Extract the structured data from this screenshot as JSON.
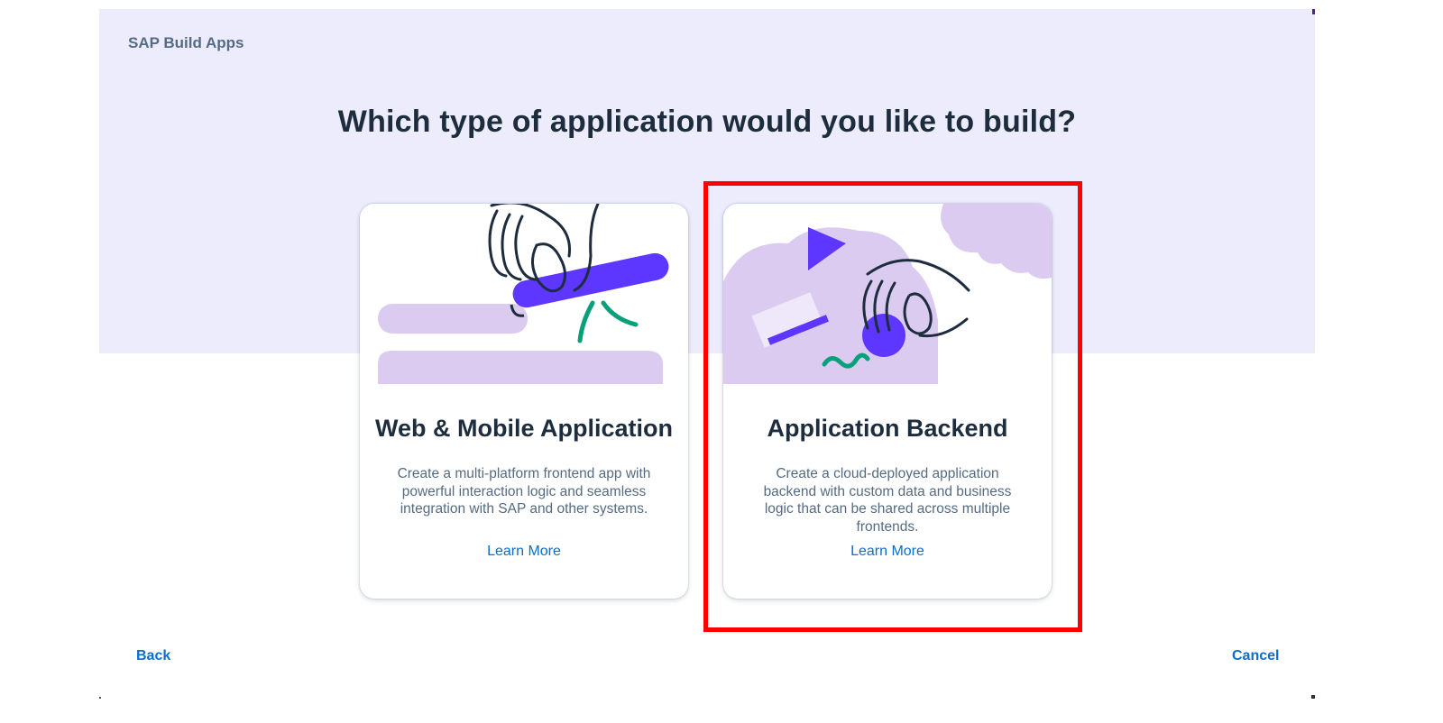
{
  "header": {
    "app_name": "SAP Build Apps"
  },
  "main": {
    "question": "Which type of application would you like to build?",
    "cards": [
      {
        "title": "Web & Mobile Application",
        "description": "Create a multi-platform frontend app with powerful interaction logic and seamless integration with SAP and other systems.",
        "link": "Learn More",
        "icon": "hand-holding-bar-illustration"
      },
      {
        "title": "Application Backend",
        "description": "Create a cloud-deployed application backend with custom data and business logic that can be shared across multiple frontends.",
        "link": "Learn More",
        "icon": "hand-holding-circle-illustration"
      }
    ]
  },
  "footer": {
    "back_label": "Back",
    "cancel_label": "Cancel"
  },
  "colors": {
    "hero_bg": "#ececfd",
    "accent_purple": "#5d36ff",
    "soft_lilac": "#dccbf0",
    "teal": "#07a07b",
    "link_blue": "#0a6ed1",
    "highlight_red": "#ff0000"
  }
}
